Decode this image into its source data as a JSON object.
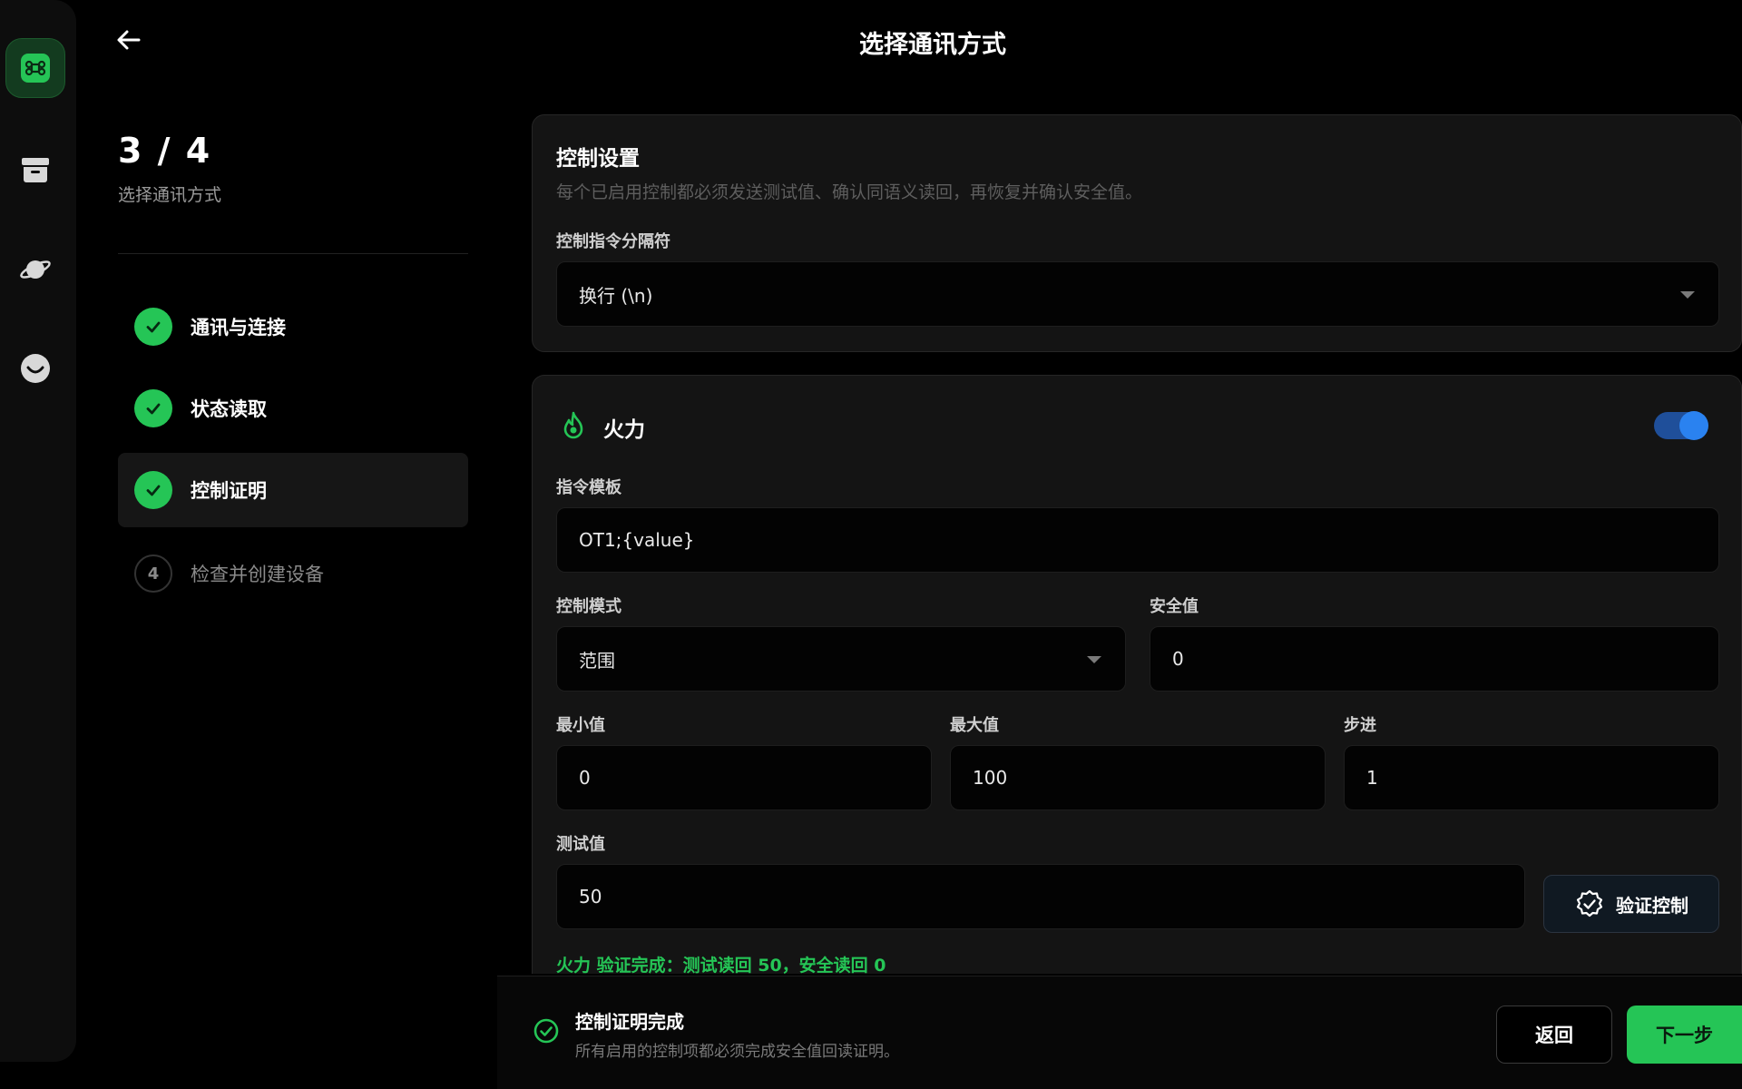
{
  "header": {
    "title": "选择通讯方式"
  },
  "rail": {
    "items": [
      {
        "icon": "command-icon",
        "active": true
      },
      {
        "icon": "archive-box-icon",
        "active": false
      },
      {
        "icon": "planet-icon",
        "active": false
      },
      {
        "icon": "smiley-icon",
        "active": false
      }
    ]
  },
  "stepper": {
    "count": "3 / 4",
    "subtitle": "选择通讯方式",
    "steps": [
      {
        "label": "通讯与连接",
        "state": "done"
      },
      {
        "label": "状态读取",
        "state": "done"
      },
      {
        "label": "控制证明",
        "state": "done-active"
      },
      {
        "number": "4",
        "label": "检查并创建设备",
        "state": "pending"
      }
    ]
  },
  "control_settings": {
    "title": "控制设置",
    "description": "每个已启用控制都必须发送测试值、确认同语义读回，再恢复并确认安全值。",
    "delimiter_label": "控制指令分隔符",
    "delimiter_value": "换行 (\\n)"
  },
  "fire_card": {
    "title": "火力",
    "enabled": true,
    "template_label": "指令模板",
    "template_value": "OT1;{value}",
    "mode_label": "控制模式",
    "mode_value": "范围",
    "safe_label": "安全值",
    "safe_value": "0",
    "min_label": "最小值",
    "min_value": "0",
    "max_label": "最大值",
    "max_value": "100",
    "step_label": "步进",
    "step_value": "1",
    "test_label": "测试值",
    "test_value": "50",
    "verify_button": "验证控制",
    "verify_result": "火力 验证完成：测试读回 50，安全读回 0"
  },
  "footer": {
    "title": "控制证明完成",
    "description": "所有启用的控制项都必须完成安全值回读证明。",
    "back_label": "返回",
    "next_label": "下一步"
  },
  "colors": {
    "accent_green": "#25c556",
    "toggle_blue": "#2a82f0",
    "background": "#000000",
    "card": "#141414"
  }
}
